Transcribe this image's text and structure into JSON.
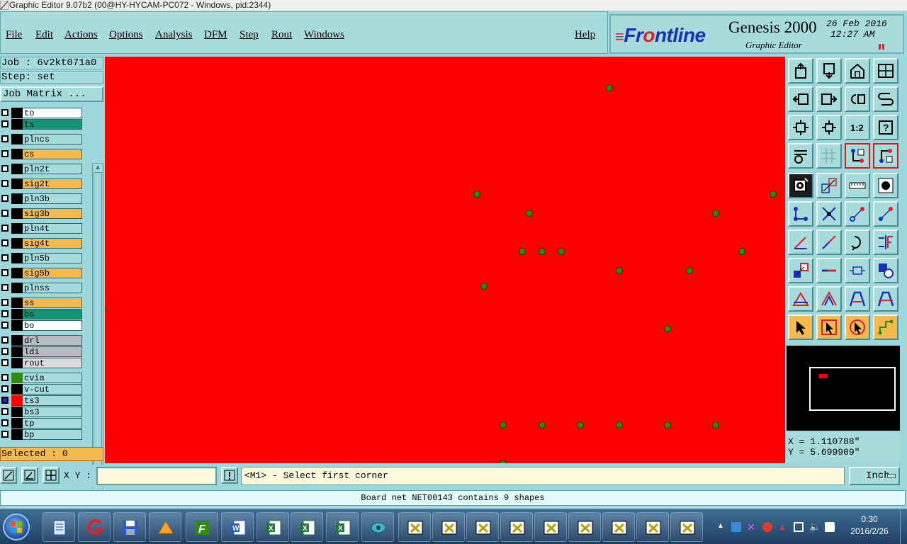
{
  "window": {
    "title": "Graphic Editor 9.07b2 (00@HY-HYCAM-PC072 - Windows, pid:2344)"
  },
  "menu": {
    "items": [
      {
        "label": "File"
      },
      {
        "label": "Edit"
      },
      {
        "label": "Actions"
      },
      {
        "label": "Options"
      },
      {
        "label": "Analysis"
      },
      {
        "label": "DFM"
      },
      {
        "label": "Step"
      },
      {
        "label": "Rout"
      },
      {
        "label": "Windows"
      }
    ],
    "help": "Help"
  },
  "brand": {
    "logo_left": "Fr",
    "logo_o": "o",
    "logo_right": "ntline",
    "product": "Genesis 2000",
    "subtitle": "Graphic Editor",
    "date": "26 Feb 2016",
    "time": "12:27 AM"
  },
  "left_panel": {
    "job_label": "Job : 6v2kt071a0",
    "step_label": "Step: set",
    "job_matrix_button": "Job Matrix ...",
    "selected_label": "Selected : 0",
    "layers": [
      {
        "name": "to",
        "color": "#ffffff",
        "swatch": "#000000"
      },
      {
        "name": "ts",
        "color": "#139473",
        "swatch": "#000000"
      },
      {
        "name": "plncs",
        "color": "#a8dcdc",
        "swatch": "#000000"
      },
      {
        "name": "cs",
        "color": "#f5b94e",
        "swatch": "#000000"
      },
      {
        "name": "pln2t",
        "color": "#a8dcdc",
        "swatch": "#000000"
      },
      {
        "name": "sig2t",
        "color": "#f5b94e",
        "swatch": "#000000"
      },
      {
        "name": "pln3b",
        "color": "#a8dcdc",
        "swatch": "#000000"
      },
      {
        "name": "sig3b",
        "color": "#f5b94e",
        "swatch": "#000000"
      },
      {
        "name": "pln4t",
        "color": "#a8dcdc",
        "swatch": "#000000"
      },
      {
        "name": "sig4t",
        "color": "#f5b94e",
        "swatch": "#000000"
      },
      {
        "name": "pln5b",
        "color": "#a8dcdc",
        "swatch": "#000000"
      },
      {
        "name": "sig5b",
        "color": "#f5b94e",
        "swatch": "#000000"
      },
      {
        "name": "plnss",
        "color": "#a8dcdc",
        "swatch": "#000000"
      },
      {
        "name": "ss",
        "color": "#f5b94e",
        "swatch": "#000000"
      },
      {
        "name": "bs",
        "color": "#139473",
        "swatch": "#000000"
      },
      {
        "name": "bo",
        "color": "#ffffff",
        "swatch": "#000000"
      },
      {
        "name": "drl",
        "color": "#b8bcc0",
        "swatch": "#000000"
      },
      {
        "name": "ldi",
        "color": "#b8bcc0",
        "swatch": "#000000"
      },
      {
        "name": "rout",
        "color": "#dadada",
        "swatch": "#000000"
      },
      {
        "name": "cvia",
        "color": "#a8dcdc",
        "swatch": "#2d8a12"
      },
      {
        "name": "v-cut",
        "color": "#a8dcdc",
        "swatch": "#000000"
      },
      {
        "name": "ts3",
        "color": "#a8dcdc",
        "swatch": "#ff0000",
        "checked": true
      },
      {
        "name": "bs3",
        "color": "#a8dcdc",
        "swatch": "#000000"
      },
      {
        "name": "tp",
        "color": "#a8dcdc",
        "swatch": "#000000"
      },
      {
        "name": "bp",
        "color": "#a8dcdc",
        "swatch": "#000000"
      }
    ]
  },
  "canvas": {
    "background": "#ff0000",
    "pad_color": "#2d8a12"
  },
  "coords": {
    "x": "X = 1.110788\"",
    "y": "Y = 5.699909\""
  },
  "command": {
    "xy_label": "X Y :",
    "xy_value": "",
    "prompt": "<M1> - Select first corner",
    "unit": "Inch"
  },
  "status": {
    "message": "Board net NET00143 contains 9 shapes"
  },
  "taskbar": {
    "time": "0:30",
    "date": "2016/2/26"
  }
}
